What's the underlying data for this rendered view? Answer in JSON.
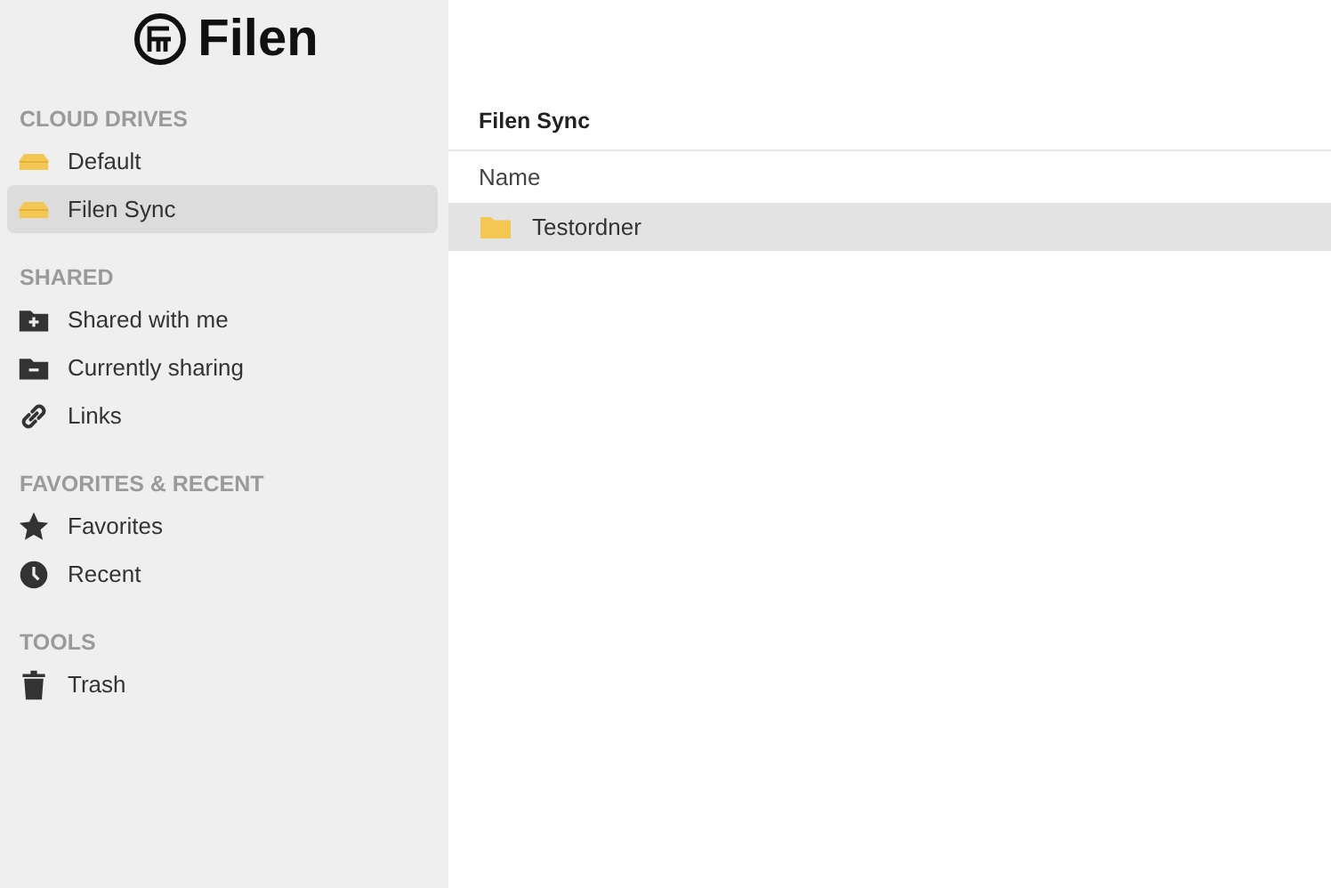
{
  "logo": {
    "text": "Filen"
  },
  "sidebar": {
    "sections": [
      {
        "title": "CLOUD DRIVES",
        "items": [
          {
            "kind": "drive",
            "label": "Default",
            "selected": false
          },
          {
            "kind": "drive",
            "label": "Filen Sync",
            "selected": true
          }
        ]
      },
      {
        "title": "SHARED",
        "items": [
          {
            "kind": "incoming",
            "label": "Shared with me",
            "selected": false
          },
          {
            "kind": "outgoing",
            "label": "Currently sharing",
            "selected": false
          },
          {
            "kind": "link",
            "label": "Links",
            "selected": false
          }
        ]
      },
      {
        "title": "FAVORITES & RECENT",
        "items": [
          {
            "kind": "favorite",
            "label": "Favorites",
            "selected": false
          },
          {
            "kind": "recent",
            "label": "Recent",
            "selected": false
          }
        ]
      },
      {
        "title": "TOOLS",
        "items": [
          {
            "kind": "trash",
            "label": "Trash",
            "selected": false
          }
        ]
      }
    ]
  },
  "main": {
    "title": "Filen Sync",
    "columns": [
      "Name"
    ],
    "rows": [
      {
        "name": "Testordner",
        "selected": true
      }
    ]
  }
}
